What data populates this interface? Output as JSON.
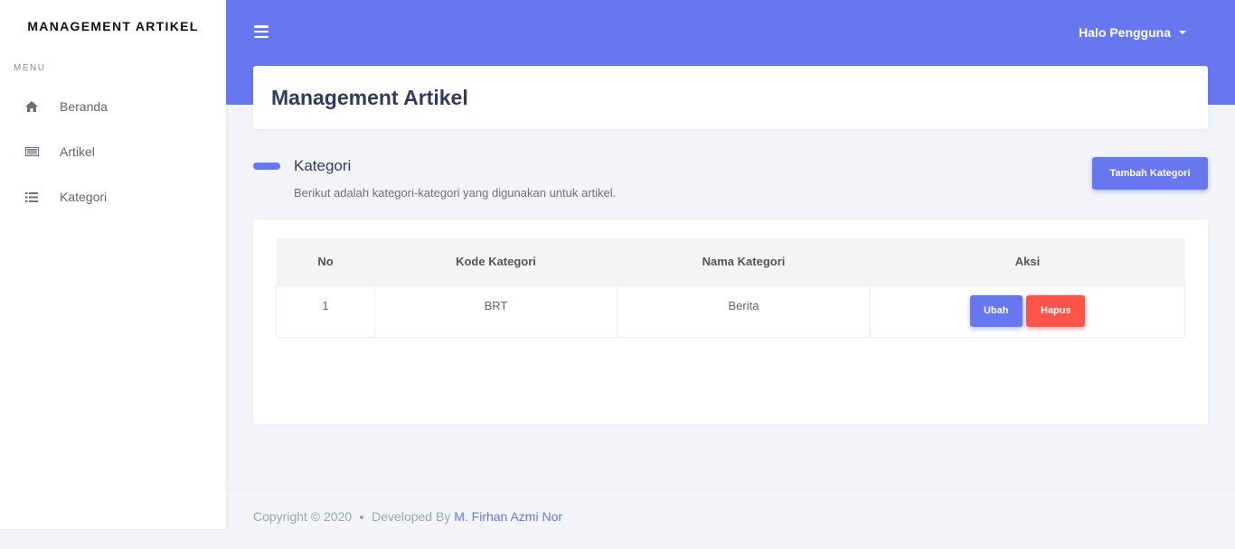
{
  "sidebar": {
    "brand": "MANAGEMENT ARTIKEL",
    "menu_label": "MENU",
    "items": [
      {
        "label": "Beranda",
        "icon": "home-icon"
      },
      {
        "label": "Artikel",
        "icon": "newspaper-icon"
      },
      {
        "label": "Kategori",
        "icon": "list-icon"
      }
    ]
  },
  "topbar": {
    "menu_icon": "hamburger-icon",
    "user_label": "Halo Pengguna",
    "accent_color": "#6777ef"
  },
  "page": {
    "title": "Management Artikel"
  },
  "section": {
    "title": "Kategori",
    "lead": "Berikut adalah kategori-kategori yang digunakan untuk artikel.",
    "add_button": "Tambah Kategori"
  },
  "table": {
    "headers": [
      "No",
      "Kode Kategori",
      "Nama Kategori",
      "Aksi"
    ],
    "rows": [
      {
        "no": "1",
        "kode": "BRT",
        "nama": "Berita",
        "edit_label": "Ubah",
        "delete_label": "Hapus"
      }
    ]
  },
  "footer": {
    "copyright": "Copyright © 2020",
    "developed_by": "Developed By",
    "author": "M. Firhan Azmi Nor"
  },
  "colors": {
    "primary": "#6777ef",
    "danger": "#fc544b"
  }
}
